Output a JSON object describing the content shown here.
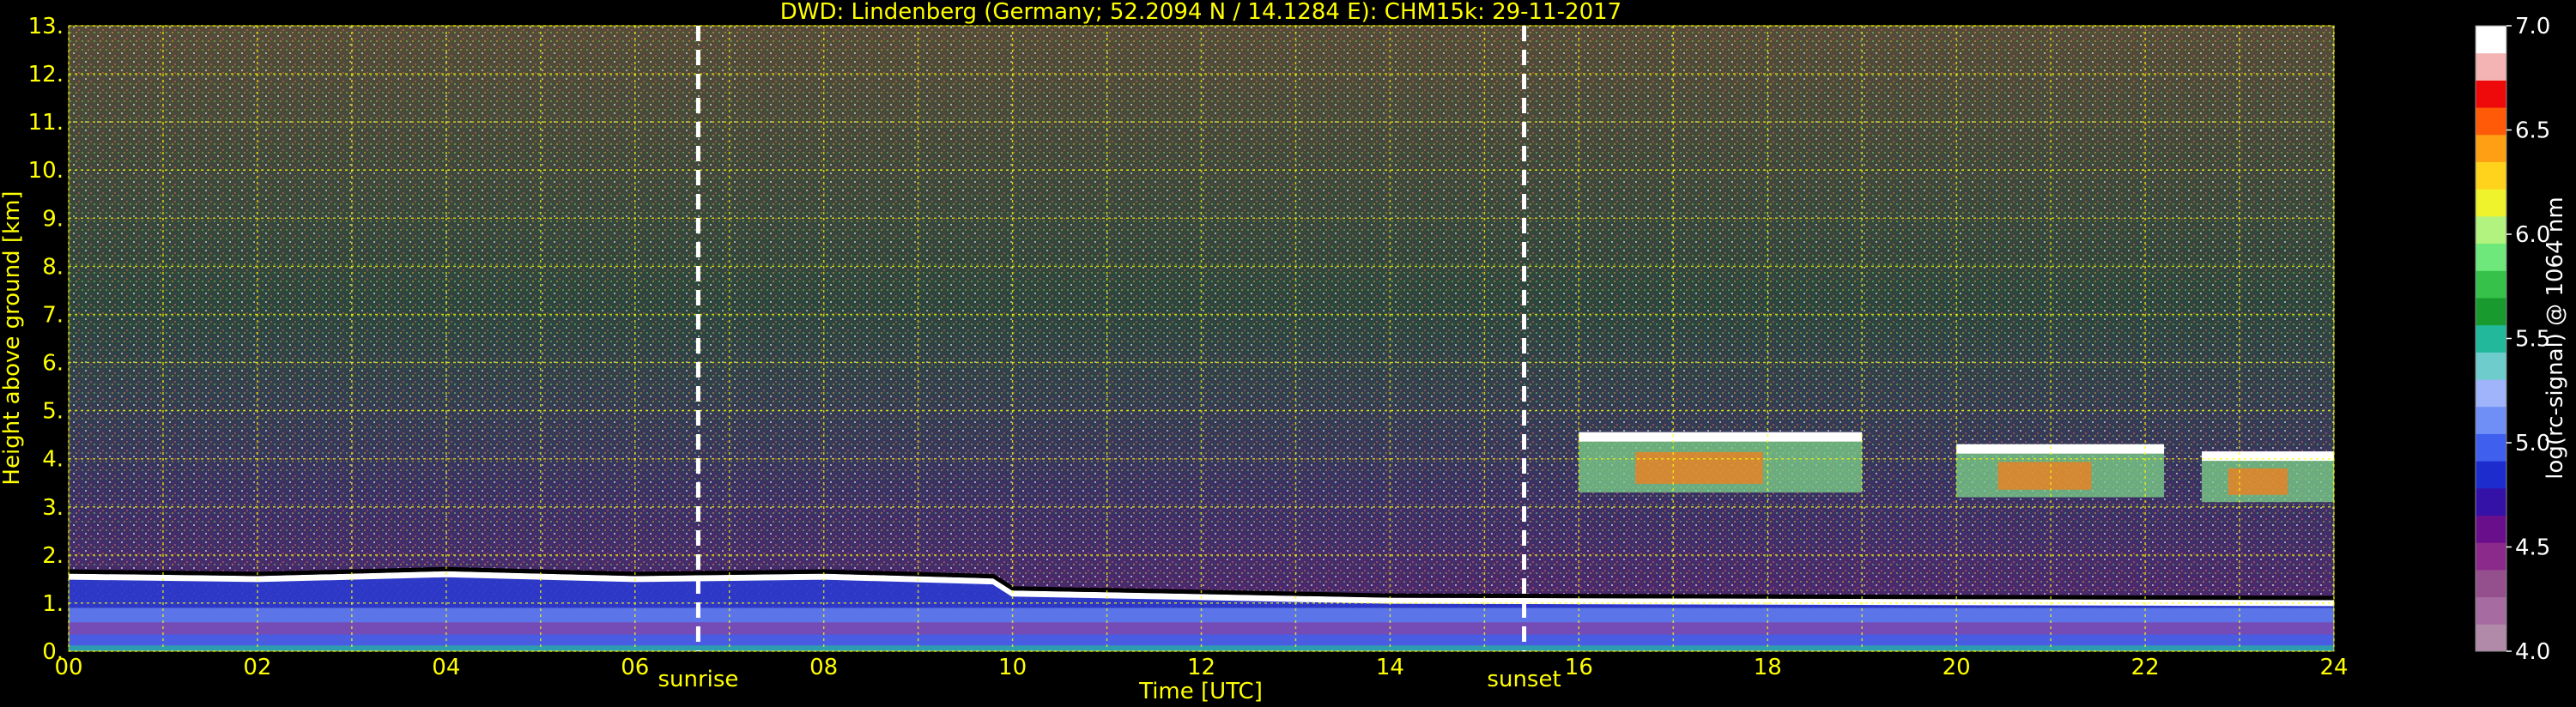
{
  "title": "DWD: Lindenberg (Germany; 52.2094 N / 14.1284 E):    CHM15k: 29-11-2017",
  "colors": {
    "background": "#000000",
    "axis_text": "#ffff00",
    "grid": "#ffff00",
    "marker_lines": "#ffffff"
  },
  "chart_data": {
    "type": "heatmap",
    "xlabel": "Time [UTC]",
    "ylabel": "Height above ground [km]",
    "xlim": [
      0,
      24
    ],
    "ylim": [
      0,
      13
    ],
    "x_ticks": [
      "00",
      "02",
      "04",
      "06",
      "08",
      "10",
      "12",
      "14",
      "16",
      "18",
      "20",
      "22",
      "24"
    ],
    "y_ticks": [
      "0.",
      "1.",
      "2.",
      "3.",
      "4.",
      "5.",
      "6.",
      "7.",
      "8.",
      "9.",
      "10.",
      "11.",
      "12.",
      "13."
    ],
    "grid": true,
    "markers": [
      {
        "label": "sunrise",
        "x": 6.67
      },
      {
        "label": "sunset",
        "x": 15.42
      }
    ],
    "colorbar": {
      "label": "log(rc-signal) @ 1064 nm",
      "range": [
        4.0,
        7.0
      ],
      "ticks": [
        "4.0",
        "4.5",
        "5.0",
        "5.5",
        "6.0",
        "6.5",
        "7.0"
      ],
      "colors": [
        "#b08aa8",
        "#a66ba0",
        "#94508c",
        "#8b2a8b",
        "#6a0f8c",
        "#3412a8",
        "#1d2ccc",
        "#3f60ee",
        "#6f8ef6",
        "#9fb4fa",
        "#6fcccc",
        "#22b89c",
        "#189a2e",
        "#36c24a",
        "#6ee87a",
        "#b2f27e",
        "#eef32c",
        "#ffd21c",
        "#ff9f14",
        "#ff5a08",
        "#ee0a0a",
        "#f4b4b4",
        "#ffffff"
      ]
    },
    "features": {
      "boundary_layer_top_km": [
        {
          "x": 0.0,
          "y": 1.55
        },
        {
          "x": 2.0,
          "y": 1.5
        },
        {
          "x": 4.0,
          "y": 1.6
        },
        {
          "x": 6.0,
          "y": 1.5
        },
        {
          "x": 8.0,
          "y": 1.55
        },
        {
          "x": 9.8,
          "y": 1.45
        },
        {
          "x": 10.0,
          "y": 1.2
        },
        {
          "x": 14.0,
          "y": 1.05
        },
        {
          "x": 24.0,
          "y": 1.0
        }
      ],
      "cloud_segments": [
        {
          "x0": 16.0,
          "x1": 19.0,
          "base_km": 3.3,
          "top_km": 4.5
        },
        {
          "x0": 20.0,
          "x1": 22.2,
          "base_km": 3.2,
          "top_km": 4.25
        },
        {
          "x0": 22.6,
          "x1": 24.0,
          "base_km": 3.1,
          "top_km": 4.1
        }
      ]
    }
  }
}
